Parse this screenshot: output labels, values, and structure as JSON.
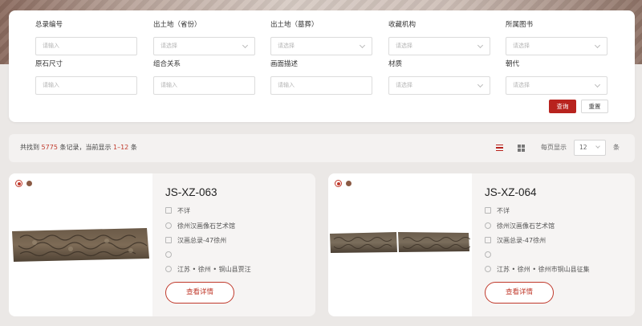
{
  "filters": {
    "fields": [
      {
        "label": "总录编号",
        "placeholder": "请输入",
        "type": "input"
      },
      {
        "label": "出土地（省份）",
        "placeholder": "请选择",
        "type": "select"
      },
      {
        "label": "出土地（墓葬）",
        "placeholder": "请选择",
        "type": "select"
      },
      {
        "label": "收藏机构",
        "placeholder": "请选择",
        "type": "select"
      },
      {
        "label": "所属图书",
        "placeholder": "请选择",
        "type": "select"
      },
      {
        "label": "原石尺寸",
        "placeholder": "请输入",
        "type": "input"
      },
      {
        "label": "组合关系",
        "placeholder": "请输入",
        "type": "input"
      },
      {
        "label": "画面描述",
        "placeholder": "请输入",
        "type": "input"
      },
      {
        "label": "材质",
        "placeholder": "请选择",
        "type": "select"
      },
      {
        "label": "朝代",
        "placeholder": "请选择",
        "type": "select"
      }
    ],
    "search_label": "查询",
    "reset_label": "重置"
  },
  "results": {
    "prefix": "共找到",
    "total": "5775",
    "middle": "条记录，当前显示",
    "range": "1–12",
    "suffix": "条",
    "per_page_label": "每页显示",
    "per_page_value": "12",
    "per_page_unit": "条"
  },
  "cards": [
    {
      "title": "JS-XZ-063",
      "dynasty": "不详",
      "institution": "徐州汉画像石艺术馆",
      "book": "汉画总录-47徐州",
      "dimensions": "",
      "location": "江苏 • 徐州 • 铜山县贾汪",
      "detail_label": "查看详情"
    },
    {
      "title": "JS-XZ-064",
      "dynasty": "不详",
      "institution": "徐州汉画像石艺术馆",
      "book": "汉画总录-47徐州",
      "dimensions": "",
      "location": "江苏 • 徐州 • 徐州市铜山县征集",
      "detail_label": "查看详情"
    }
  ],
  "colors": {
    "accent": "#b8231e",
    "page_bg": "#ebe8e6"
  }
}
